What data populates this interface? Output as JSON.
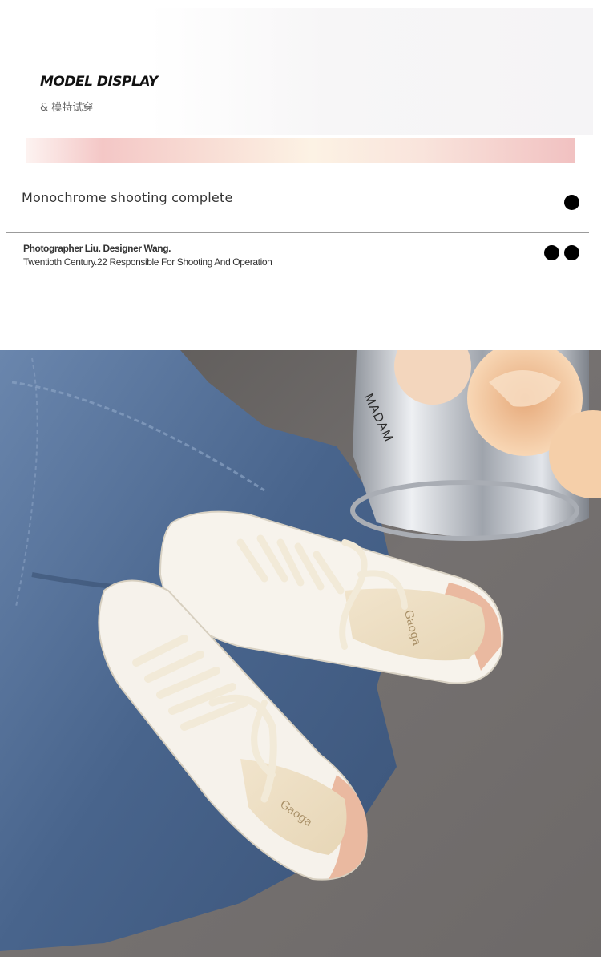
{
  "header": {
    "title": "MODEL DISPLAY",
    "subtitle": "& 模特试穿"
  },
  "section": {
    "heading": "Monochrome shooting complete"
  },
  "credits": {
    "line1": "Photographer Liu. Designer Wang.",
    "line2": "Twentioth Century.22 Responsible For Shooting And Operation"
  },
  "photo": {
    "can_text": "MADAM",
    "insole_logo_1": "Gaoga",
    "insole_logo_2": "Gaoga",
    "colors": {
      "floor": "#6f6c6b",
      "denim": "#4d6a92",
      "shoe": "#f6f2ec",
      "heel_tab": "#eab9a0",
      "rose": "#f0c49a",
      "can": "#c9cdd3"
    }
  }
}
